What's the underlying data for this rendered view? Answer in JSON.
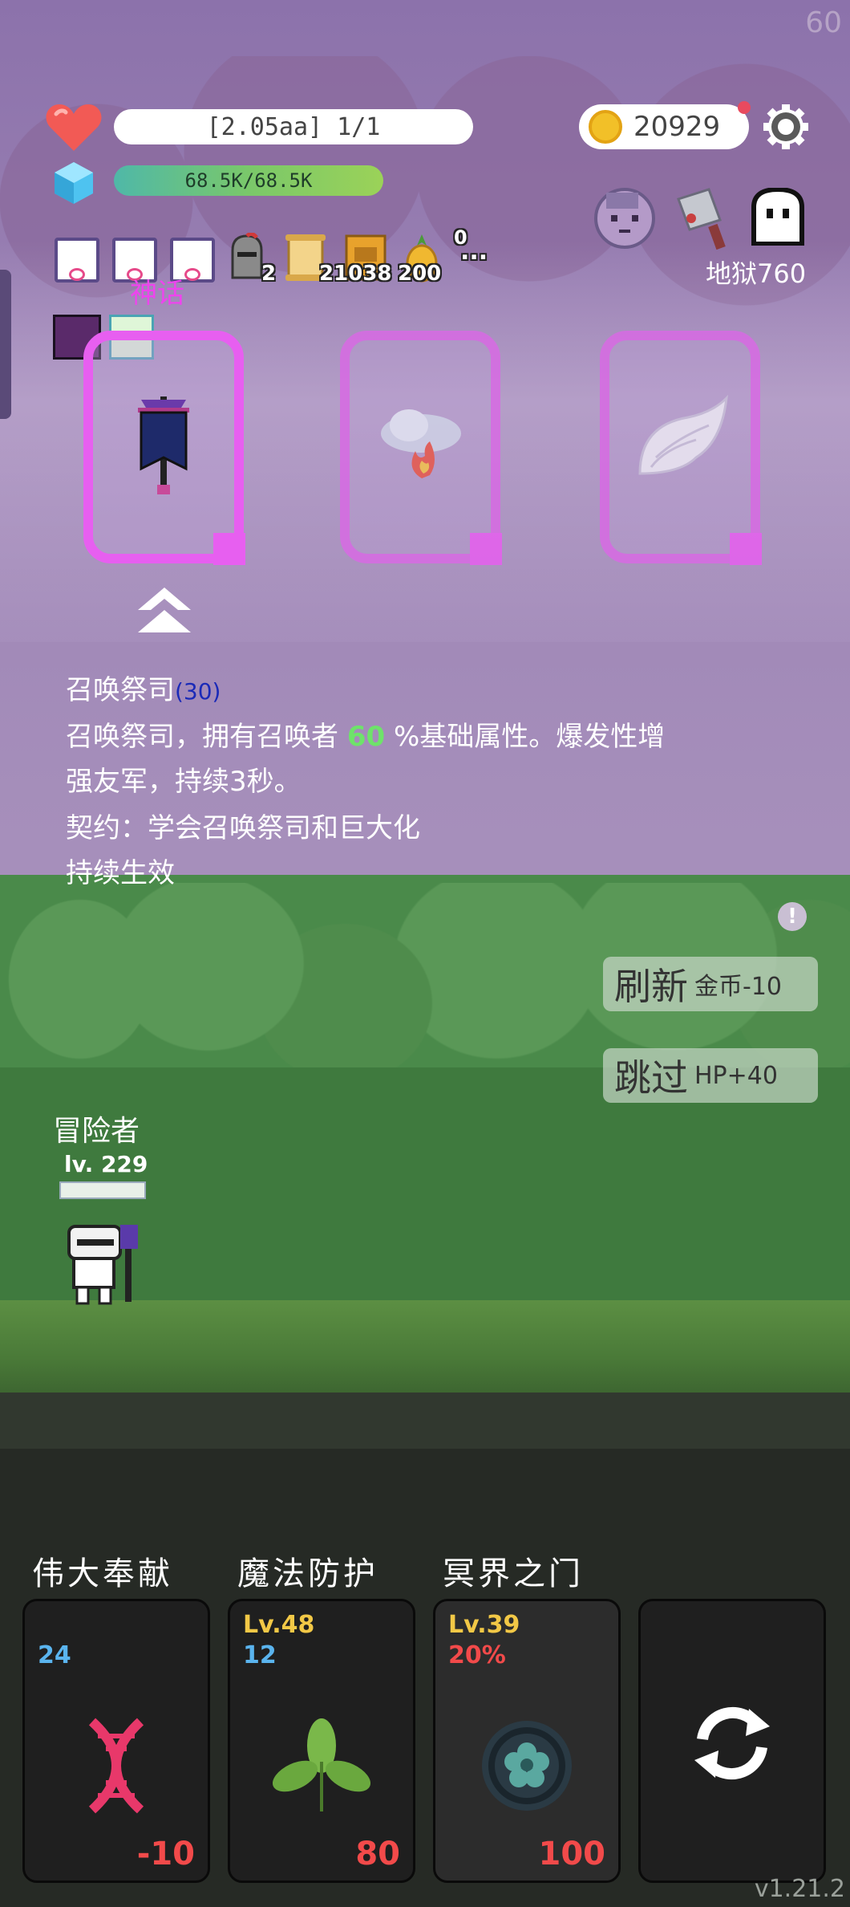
{
  "fps": "60",
  "hud": {
    "hp_text": "[2.05aa] 1/1",
    "mana_text": "68.5K/68.5K",
    "coins": "20929",
    "location": "地狱760"
  },
  "inventory": {
    "knight_count": "2",
    "map_count": "21038",
    "book_count": "",
    "pineapple_count": "200",
    "more_count": "0",
    "more": "..."
  },
  "choice": {
    "tier_label": "神话",
    "title": "召唤祭司",
    "level": "(30)",
    "line1_pre": "召唤祭司，拥有召唤者 ",
    "line1_value": "60",
    "line1_post": " %基础属性。爆发性增",
    "line2": "强友军，持续3秒。",
    "line3": "契约：学会召唤祭司和巨大化",
    "line4": "持续生效"
  },
  "actions": {
    "info": "!",
    "refresh_label": "刷新",
    "refresh_cost": "金币-10",
    "skip_label": "跳过",
    "skip_bonus": "HP+40"
  },
  "hero": {
    "name": "冒险者",
    "level": "lv. 229"
  },
  "skills": [
    {
      "label": "伟大奉献",
      "level": "",
      "num": "24",
      "num_color": "#5ab4ee",
      "cost": "-10",
      "icon": "dna-icon"
    },
    {
      "label": "魔法防护",
      "level": "Lv.48",
      "num": "12",
      "num_color": "#5ab4ee",
      "cost": "80",
      "icon": "leaf-icon"
    },
    {
      "label": "冥界之门",
      "level": "Lv.39",
      "num": "20%",
      "num_color": "#f24a4a",
      "cost": "100",
      "icon": "portal-flower-icon"
    },
    {
      "label": "",
      "level": "",
      "num": "",
      "num_color": "",
      "cost": "",
      "icon": "refresh-icon"
    }
  ],
  "version": "v1.21.2",
  "colors": {
    "card_border": "#e75ff0",
    "myth_label": "#ee44ee",
    "highlight_value": "#6ee36a",
    "cost_red": "#f24a4a",
    "level_gold": "#f2c846"
  }
}
